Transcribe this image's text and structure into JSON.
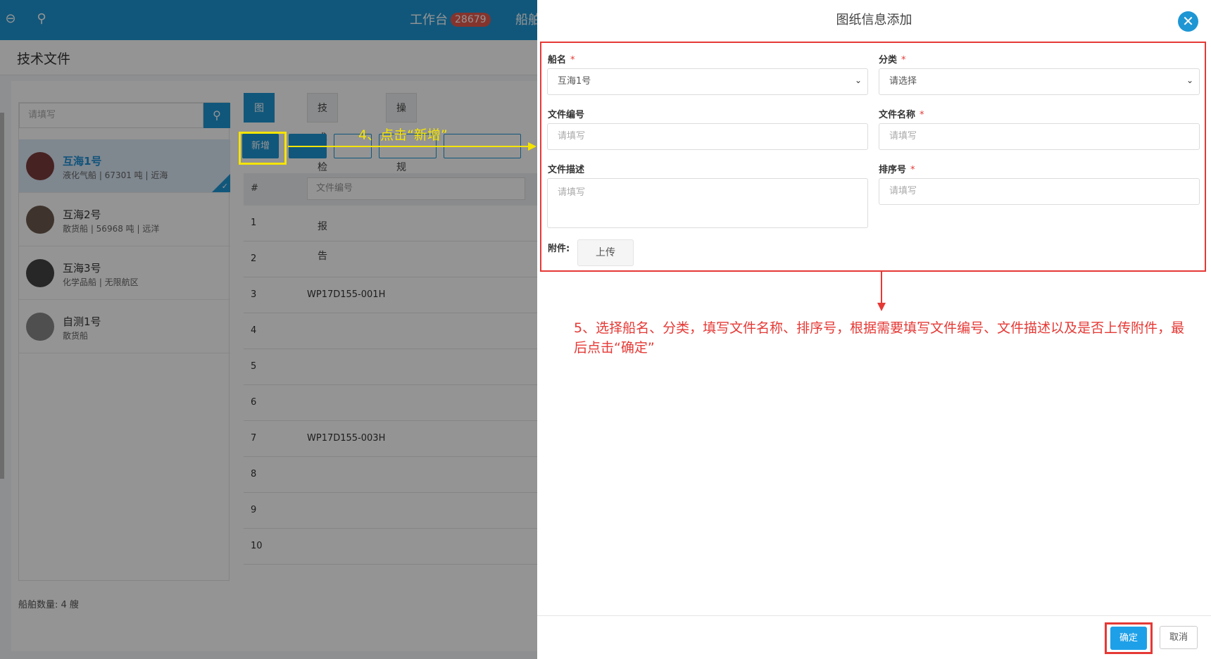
{
  "topbar": {
    "workbench_label": "工作台",
    "workbench_count": "28679",
    "next_label": "船舶"
  },
  "page": {
    "title": "技术文件"
  },
  "search": {
    "placeholder": "请填写"
  },
  "ships": [
    {
      "name": "互海1号",
      "detail": "液化气船 | 67301 吨 | 近海"
    },
    {
      "name": "互海2号",
      "detail": "散货船 | 56968 吨 | 远洋"
    },
    {
      "name": "互海3号",
      "detail": "化学品船 | 无限航区"
    },
    {
      "name": "自测1号",
      "detail": "散货船"
    }
  ],
  "ship_count": "船舶数量:  4 艘",
  "tabs": [
    "图纸信息",
    "技术检验报告",
    "操作规程"
  ],
  "toolbar": {
    "new_label": "新增"
  },
  "table": {
    "col_index": "#",
    "col_file_placeholder": "文件编号",
    "rows": [
      {
        "n": "1",
        "v": ""
      },
      {
        "n": "2",
        "v": ""
      },
      {
        "n": "3",
        "v": "WP17D155-001H"
      },
      {
        "n": "4",
        "v": ""
      },
      {
        "n": "5",
        "v": ""
      },
      {
        "n": "6",
        "v": ""
      },
      {
        "n": "7",
        "v": "WP17D155-003H"
      },
      {
        "n": "8",
        "v": ""
      },
      {
        "n": "9",
        "v": ""
      },
      {
        "n": "10",
        "v": ""
      }
    ]
  },
  "annotations": {
    "step4": "4、点击“新增”",
    "step5": "5、选择船名、分类，填写文件名称、排序号，根据需要填写文件编号、文件描述以及是否上传附件，最后点击“确定”"
  },
  "modal": {
    "title": "图纸信息添加",
    "ship_name_label": "船名",
    "ship_name_value": "互海1号",
    "category_label": "分类",
    "category_value": "请选择",
    "file_no_label": "文件编号",
    "file_no_placeholder": "请填写",
    "file_name_label": "文件名称",
    "file_name_placeholder": "请填写",
    "desc_label": "文件描述",
    "desc_placeholder": "请填写",
    "sort_label": "排序号",
    "sort_placeholder": "请填写",
    "attach_label": "附件:",
    "upload_label": "上传",
    "required_mark": "*",
    "ok_label": "确定",
    "cancel_label": "取消"
  },
  "colors": {
    "primary": "#1e96d4",
    "highlight_yellow": "#f5e400",
    "annotation_red": "#e53935"
  }
}
